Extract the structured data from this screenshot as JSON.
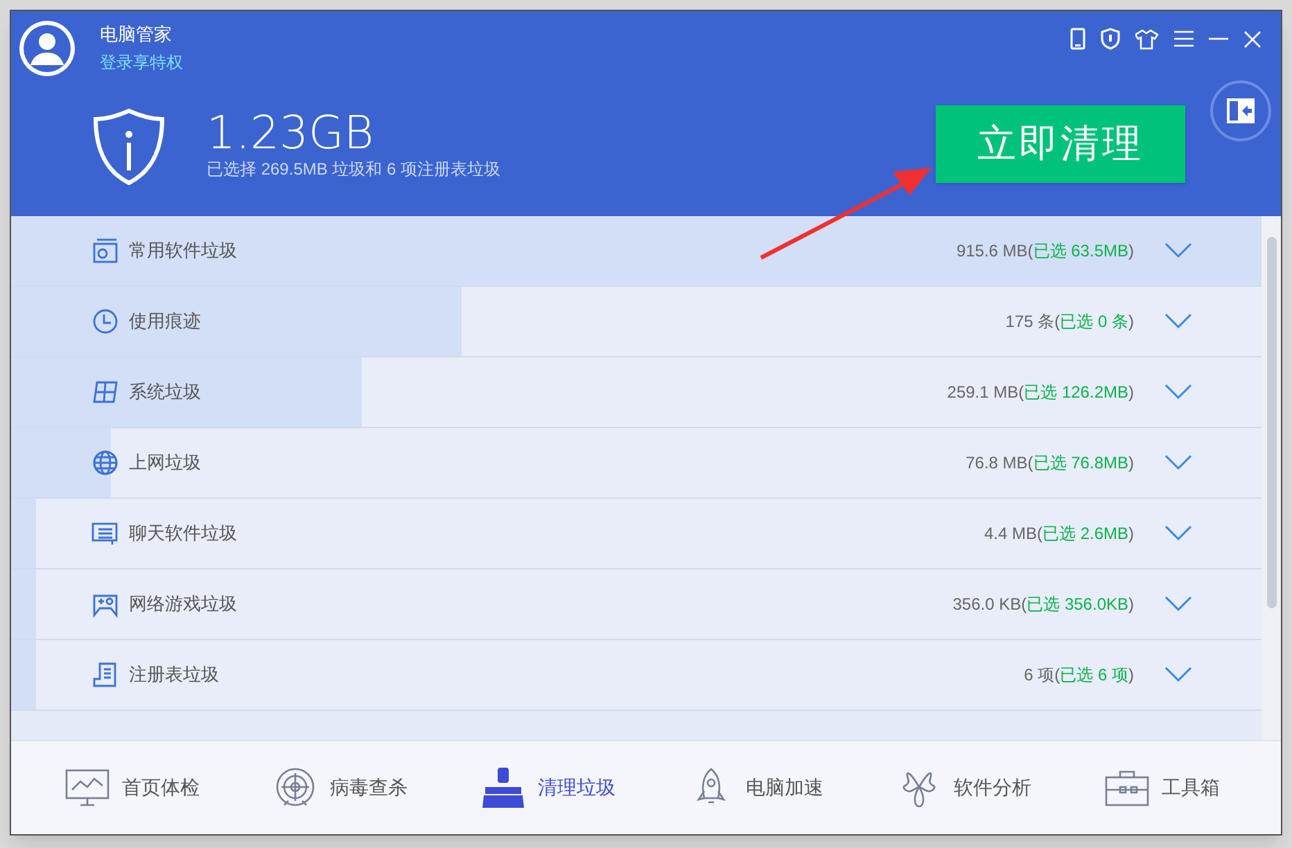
{
  "window": {
    "title": "电脑管家",
    "login_link": "登录享特权"
  },
  "summary": {
    "total": "1.23GB",
    "detail": "已选择 269.5MB 垃圾和 6 项注册表垃圾",
    "clean_button": "立即清理"
  },
  "categories": [
    {
      "kind": "software",
      "label": "常用软件垃圾",
      "size": "915.6 MB(",
      "selected_text": "已选 63.5MB",
      "close": ")",
      "level": 1
    },
    {
      "kind": "history",
      "label": "使用痕迹",
      "size": "175 条(",
      "selected_text": "已选 0 条",
      "close": ")",
      "level": 0.36
    },
    {
      "kind": "system",
      "label": "系统垃圾",
      "size": "259.1 MB(",
      "selected_text": "已选 126.2MB",
      "close": ")",
      "level": 0.28
    },
    {
      "kind": "web",
      "label": "上网垃圾",
      "size": "76.8 MB(",
      "selected_text": "已选 76.8MB",
      "close": ")",
      "level": 0.08
    },
    {
      "kind": "chat",
      "label": "聊天软件垃圾",
      "size": "4.4 MB(",
      "selected_text": "已选 2.6MB",
      "close": ")",
      "level": 0.02
    },
    {
      "kind": "game",
      "label": "网络游戏垃圾",
      "size": "356.0 KB(",
      "selected_text": "已选 356.0KB",
      "close": ")",
      "level": 0.02
    },
    {
      "kind": "registry",
      "label": "注册表垃圾",
      "size": "6 项(",
      "selected_text": "已选 6 项",
      "close": ")",
      "level": 0.02
    }
  ],
  "nav": [
    {
      "kind": "checkup",
      "label": "首页体检",
      "selected": false
    },
    {
      "kind": "virus",
      "label": "病毒查杀",
      "selected": false
    },
    {
      "kind": "clean",
      "label": "清理垃圾",
      "selected": true
    },
    {
      "kind": "speed",
      "label": "电脑加速",
      "selected": false
    },
    {
      "kind": "software",
      "label": "软件分析",
      "selected": false
    },
    {
      "kind": "toolbox",
      "label": "工具箱",
      "selected": false
    }
  ]
}
